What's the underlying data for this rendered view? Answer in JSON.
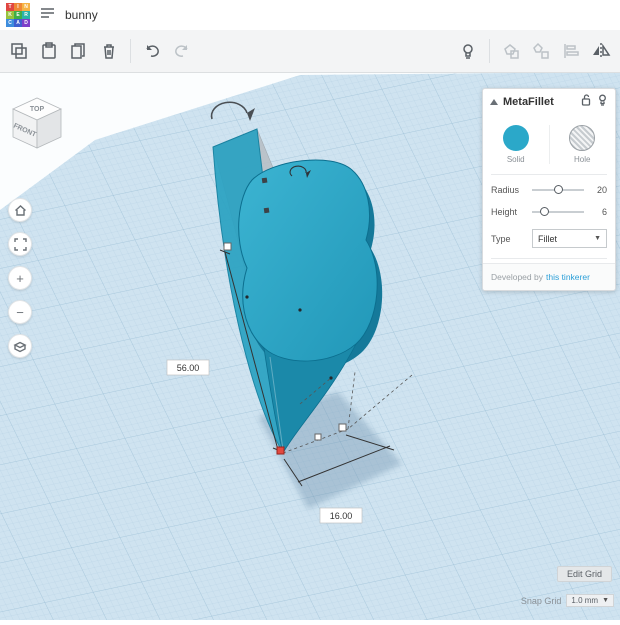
{
  "topbar": {
    "title": "bunny",
    "logo": [
      "T",
      "I",
      "N",
      "K",
      "E",
      "R",
      "C",
      "A",
      "D"
    ]
  },
  "viewcube": {
    "top": "TOP",
    "front": "FRONT"
  },
  "nav": {
    "zoom_in": "+",
    "zoom_out": "−"
  },
  "scene": {
    "dim_vertical": "56.00",
    "dim_horizontal": "16.00"
  },
  "panel": {
    "title": "MetaFillet",
    "solid_label": "Solid",
    "hole_label": "Hole",
    "radius_label": "Radius",
    "radius_value": "20",
    "height_label": "Height",
    "height_value": "6",
    "type_label": "Type",
    "type_value": "Fillet",
    "developed_by": "Developed by",
    "developer_link": "this tinkerer"
  },
  "grid_controls": {
    "edit_grid": "Edit Grid",
    "snap_label": "Snap Grid",
    "snap_value": "1.0 mm"
  },
  "colors": {
    "accent": "#2ba8c9",
    "solid_teal": "#2fa9c9",
    "workplane": "#cfe3f0",
    "selection_red": "#e2493f"
  }
}
